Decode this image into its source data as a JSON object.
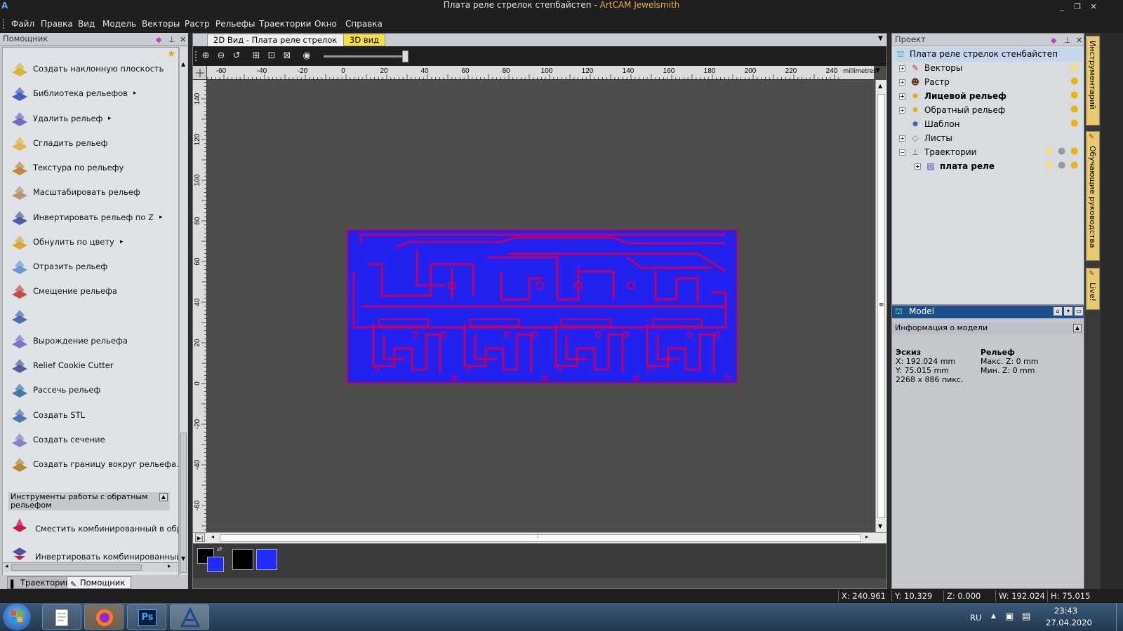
{
  "window": {
    "title_doc": "Плата реле стрелок степбайстеп",
    "title_sep": " - ",
    "title_app": "ArtCAM Jewelsmith",
    "minimize": "_",
    "restore": "❐",
    "close": "✕"
  },
  "menu": [
    "Файл",
    "Правка",
    "Вид",
    "Модель",
    "Векторы",
    "Растр",
    "Рельефы",
    "Траектории",
    "Окно",
    "Справка"
  ],
  "helper": {
    "title": "Помощник",
    "tools": [
      {
        "label": "Создать наклонную плоскость",
        "arrow": "",
        "icon": "slope-plane-icon"
      },
      {
        "label": "Библиотека рельефов",
        "arrow": "▸",
        "icon": "relief-library-icon"
      },
      {
        "label": "Удалить рельеф",
        "arrow": "▸",
        "icon": "delete-relief-icon"
      },
      {
        "label": "Сгладить рельеф",
        "arrow": "",
        "icon": "smooth-relief-icon"
      },
      {
        "label": "Текстура по рельефу",
        "arrow": "",
        "icon": "texture-relief-icon"
      },
      {
        "label": "Масштабировать рельеф",
        "arrow": "",
        "icon": "scale-relief-icon"
      },
      {
        "label": "Инвертировать рельеф по Z",
        "arrow": "▸",
        "icon": "invert-relief-icon"
      },
      {
        "label": "Обнулить по цвету",
        "arrow": "▸",
        "icon": "zero-by-color-icon"
      },
      {
        "label": "Отразить рельеф",
        "arrow": "",
        "icon": "mirror-relief-icon"
      },
      {
        "label": "Смещение рельефа",
        "arrow": "",
        "icon": "offset-relief-icon"
      },
      {
        "label": "",
        "arrow": "",
        "icon": "relief-tool-icon"
      },
      {
        "label": "Вырождение рельефа",
        "arrow": "",
        "icon": "degenerate-relief-icon"
      },
      {
        "label": "Relief Cookie Cutter",
        "arrow": "",
        "icon": "cookie-cutter-icon"
      },
      {
        "label": "Рассечь рельеф",
        "arrow": "",
        "icon": "split-relief-icon"
      },
      {
        "label": "Создать STL",
        "arrow": "",
        "icon": "stl-icon"
      },
      {
        "label": "Создать сечение",
        "arrow": "",
        "icon": "section-icon"
      },
      {
        "label": "Создать границу вокруг рельефа...",
        "arrow": "",
        "icon": "border-relief-icon"
      }
    ],
    "section_title": "Инструменты работы с обратным рельефом",
    "back_tools": [
      {
        "label": "Сместить комбинированный в обратный",
        "icon": "shift-combined-icon"
      },
      {
        "label": "Инвертировать комбинированный в обра...",
        "icon": "invert-combined-icon"
      }
    ],
    "tabs": [
      "Траектории",
      "Помощник"
    ]
  },
  "document": {
    "tab_2d": "2D Вид - Плата реле стрелок",
    "tab_3d": "3D вид",
    "ruler_units": "millimetres",
    "h_ticks": [
      "-60",
      "-40",
      "-20",
      "0",
      "20",
      "40",
      "60",
      "80",
      "100",
      "120",
      "140",
      "160",
      "180",
      "200",
      "220",
      "240"
    ],
    "v_ticks": [
      "140",
      "120",
      "100",
      "80",
      "60",
      "40",
      "20",
      "0",
      "-20",
      "-40",
      "-60"
    ]
  },
  "colors": {
    "primary": "#000000",
    "secondary": "#1f2bff",
    "palette": [
      "#000000",
      "#1f2bff"
    ],
    "pcb_background": "#2121f0",
    "pcb_traces": "#c0006a"
  },
  "project": {
    "title": "Проект",
    "root": "Плата реле стрелок стенбайстеп",
    "items": [
      {
        "label": "Векторы",
        "bold": false
      },
      {
        "label": "Растр",
        "bold": false
      },
      {
        "label": "Лицевой рельеф",
        "bold": true
      },
      {
        "label": "Обратный рельеф",
        "bold": false
      },
      {
        "label": "Шаблон",
        "bold": false
      },
      {
        "label": "Листы",
        "bold": false
      },
      {
        "label": "Траектории",
        "bold": false
      },
      {
        "label": "плата реле",
        "bold": true
      }
    ]
  },
  "model": {
    "title": "Model",
    "info_title": "Информация о модели",
    "sketch_label": "Эскиз",
    "sketch_x": "X: 192.024 mm",
    "sketch_y": "Y: 75.015 mm",
    "sketch_px": "2268 x 886 пикс.",
    "relief_label": "Рельеф",
    "relief_max": "Макс. Z: 0 mm",
    "relief_min": "Мин. Z: 0 mm"
  },
  "side_tabs": [
    "Инструментарий",
    "Обучающие руководства",
    "Live!"
  ],
  "status": {
    "x": "X: 240.961",
    "y": "Y: 10.329",
    "z": "Z: 0.000",
    "w": "W: 192.024",
    "h": "H: 75.015"
  },
  "taskbar": {
    "lang": "RU",
    "time": "23:43",
    "date": "27.04.2020",
    "apps": [
      "notepad-app",
      "firefox-app",
      "photoshop-app",
      "artcam-app"
    ],
    "ps_label": "Ps"
  }
}
